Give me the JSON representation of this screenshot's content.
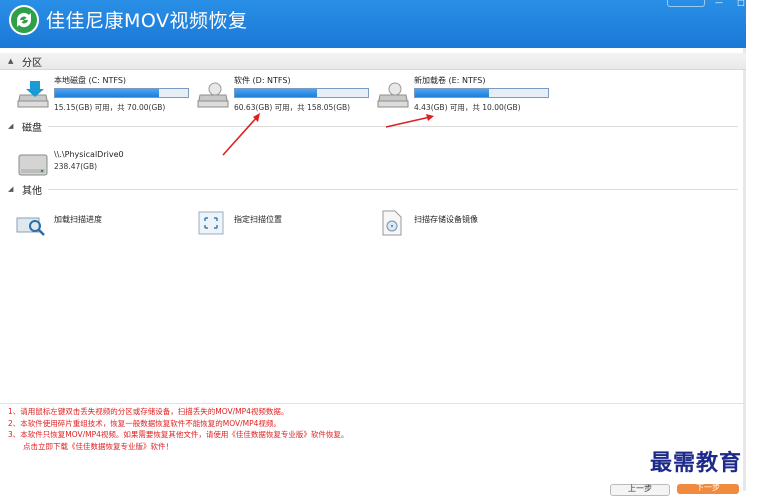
{
  "app": {
    "title": "佳佳尼康MOV视频恢复",
    "menu_label": "菜单"
  },
  "window_buttons": [
    "—",
    "□",
    "✕"
  ],
  "sections": {
    "partition": "分区",
    "disk": "磁盘",
    "other": "其他"
  },
  "partitions": [
    {
      "name": "本地磁盘 (C: NTFS)",
      "size": "15.15(GB) 可用，共 70.00(GB)",
      "used_fraction": 0.78
    },
    {
      "name": "软件 (D: NTFS)",
      "size": "60.63(GB) 可用，共 158.05(GB)",
      "used_fraction": 0.62
    },
    {
      "name": "新加载卷 (E: NTFS)",
      "size": "4.43(GB) 可用，共 10.00(GB)",
      "used_fraction": 0.56
    }
  ],
  "disks": [
    {
      "name": "\\\\.\\PhysicalDrive0",
      "size": "238.47(GB)"
    }
  ],
  "tools": [
    {
      "label": "加载扫描进度",
      "icon": "load-progress-icon"
    },
    {
      "label": "指定扫描位置",
      "icon": "scan-location-icon"
    },
    {
      "label": "扫描存储设备镜像",
      "icon": "disk-image-icon"
    }
  ],
  "notes": [
    "1、请用鼠标左键双击丢失视频的分区或存储设备，扫描丢失的MOV/MP4视频数据。",
    "2、本软件使用碎片重组技术，恢复一般数据恢复软件不能恢复的MOV/MP4视频。",
    "3、本软件只恢复MOV/MP4视频。如果需要恢复其他文件，请使用《佳佳数据恢复专业版》软件恢复。",
    "　　点击立即下载《佳佳数据恢复专业版》软件！"
  ],
  "watermark": "最需教育",
  "buttons": {
    "prev": "上一步",
    "next": "下一步"
  },
  "colors": {
    "title_bar": "#1a78d6",
    "progress": "#1d7fdc",
    "note_text": "#e02020",
    "annotation_arrow": "#e02020"
  }
}
